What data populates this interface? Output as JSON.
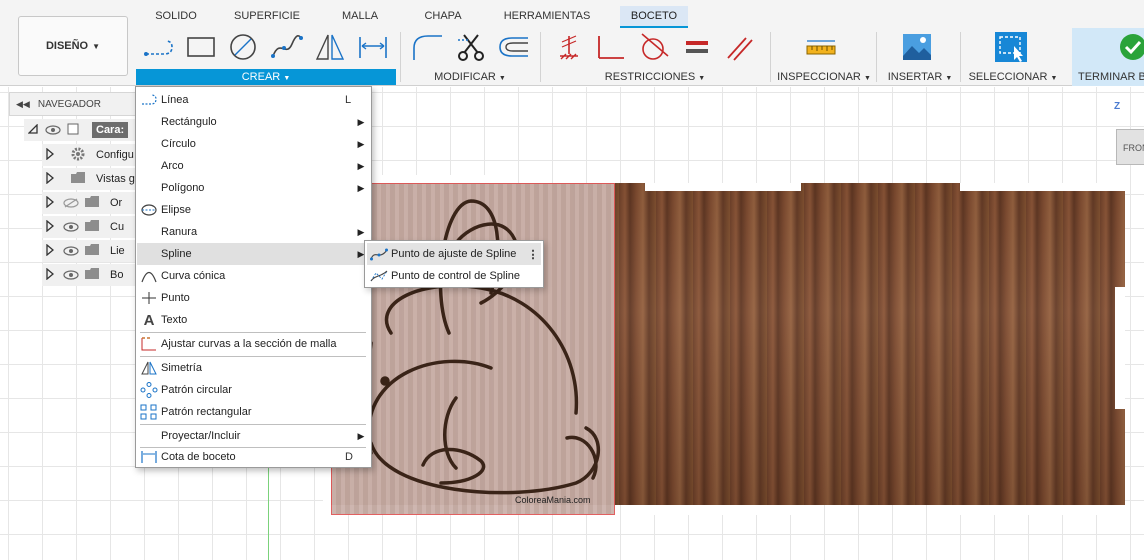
{
  "tabs": [
    "SOLIDO",
    "SUPERFICIE",
    "MALLA",
    "CHAPA",
    "HERRAMIENTAS",
    "BOCETO"
  ],
  "active_tab": "BOCETO",
  "workspace": {
    "label": "DISEÑO",
    "icon": "caret-down"
  },
  "groups": {
    "crear": "CREAR",
    "modificar": "MODIFICAR",
    "restricciones": "RESTRICCIONES",
    "inspeccionar": "INSPECCIONAR",
    "insertar": "INSERTAR",
    "seleccionar": "SELECCIONAR",
    "terminar": "TERMINAR B"
  },
  "browser": {
    "title": "NAVEGADOR",
    "rows": [
      {
        "label": "Cara:",
        "icon": "component-icon"
      },
      {
        "label": "Configu",
        "icon": "gear-icon"
      },
      {
        "label": "Vistas g",
        "icon": "folder-icon"
      },
      {
        "label": "Or",
        "icon": "folder-icon"
      },
      {
        "label": "Cu",
        "icon": "folder-icon"
      },
      {
        "label": "Lie",
        "icon": "folder-icon"
      },
      {
        "label": "Bo",
        "icon": "folder-icon"
      }
    ]
  },
  "create_menu": {
    "items": [
      {
        "label": "Línea",
        "shortcut": "L"
      },
      {
        "label": "Rectángulo"
      },
      {
        "label": "Círculo"
      },
      {
        "label": "Arco"
      },
      {
        "label": "Polígono"
      },
      {
        "label": "Elipse"
      },
      {
        "label": "Ranura"
      },
      {
        "label": "Spline"
      },
      {
        "label": "Curva cónica"
      },
      {
        "label": "Punto"
      },
      {
        "label": "Texto"
      },
      {
        "label": "Ajustar curvas a la sección de malla"
      },
      {
        "label": "Simetría"
      },
      {
        "label": "Patrón circular"
      },
      {
        "label": "Patrón rectangular"
      },
      {
        "label": "Proyectar/Incluir"
      },
      {
        "label": "Cota de boceto",
        "shortcut": "D"
      }
    ]
  },
  "spline_submenu": {
    "items": [
      {
        "label": "Punto de ajuste de Spline"
      },
      {
        "label": "Punto de control de Spline"
      }
    ]
  },
  "canvas": {
    "watermark": "ColoreaMania.com",
    "viewcube": {
      "axis": "Z",
      "face": "FRON"
    }
  },
  "colors": {
    "accent": "#0696d7",
    "menu_highlight": "#e0e0e0",
    "wood": "#7d4a2f",
    "sketch_line": "#3a2418"
  }
}
